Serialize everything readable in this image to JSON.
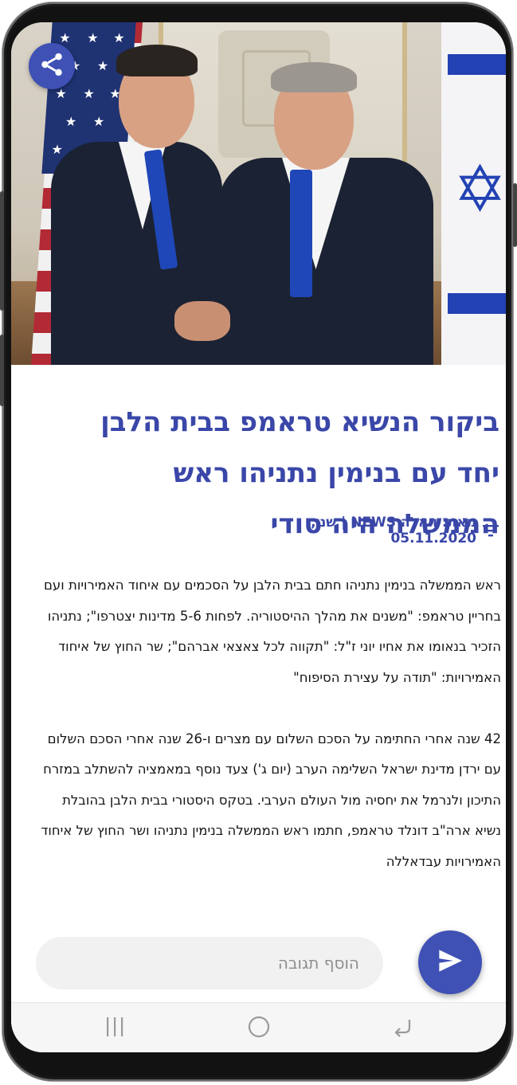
{
  "article": {
    "title": "ביקור הנשיא טראמפ בבית הלבן יחד עם בנימין נתניהו ראש הממשלה היה סודי",
    "meta": "מאת: וואלה NEWS | שני, 05.11.2020",
    "paragraphs": [
      "ראש הממשלה בנימין נתניהו חתם בבית הלבן על הסכמים עם איחוד האמירויות ועם בחריין טראמפ: \"משנים את מהלך ההיסטוריה. לפחות 5-6 מדינות יצטרפו\"; נתניהו הזכיר בנאומו את אחיו יוני ז\"ל: \"תקווה לכל צאצאי אברהם\"; שר החוץ של איחוד האמירויות: \"תודה על עצירת הסיפוח\"",
      "42 שנה אחרי החתימה על הסכם השלום עם מצרים ו-26 שנה אחרי הסכם השלום עם ירדן מדינת ישראל השלימה הערב (יום ג') צעד נוסף במאמציה להשתלב במזרח התיכון ולנרמל את יחסיה מול העולם הערבי. בטקס היסטורי בבית הלבן בהובלת נשיא ארה\"ב דונלד טראמפ, חתמו ראש הממשלה בנימין נתניהו ושר החוץ של איחוד האמירויות עבדאללה"
    ]
  },
  "comment": {
    "placeholder": "הוסף תגובה"
  },
  "icons": {
    "share": "share-icon",
    "filter": "filter-icon",
    "send": "send-icon",
    "recents": "recents-icon",
    "home": "home-icon",
    "back": "back-icon"
  },
  "colors": {
    "accent": "#3f51b5",
    "title": "#3a47a8",
    "text": "#151515",
    "input_bg": "#f1f1f1"
  }
}
